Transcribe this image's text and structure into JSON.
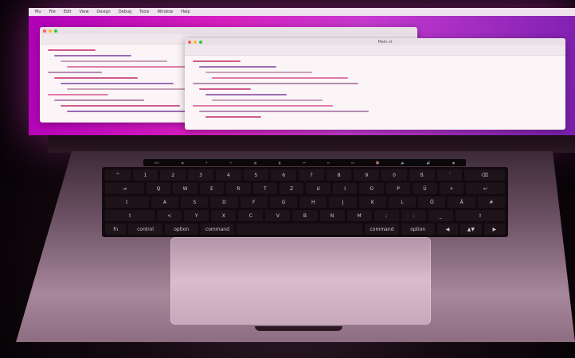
{
  "image": {
    "description_colors": {
      "screen_wallpaper": "#c81fc3",
      "body": "#7a5c70",
      "background": "#0a0508"
    }
  },
  "menubar": {
    "items": [
      "Mu",
      "File",
      "Edit",
      "View",
      "Design",
      "Debug",
      "Tools",
      "Window",
      "Help"
    ]
  },
  "window_back": {
    "title": ""
  },
  "window_front": {
    "title": "Main.st"
  },
  "touchbar": {
    "keys": [
      "esc",
      "◀",
      "☀",
      "☀",
      "▦",
      "◧",
      "⏮",
      "⏯",
      "⏭",
      "🔇",
      "🔉",
      "🔊",
      "●"
    ]
  },
  "keyboard": {
    "rows": [
      [
        "^",
        "1",
        "2",
        "3",
        "4",
        "5",
        "6",
        "7",
        "8",
        "9",
        "0",
        "ß",
        "´",
        "⌫"
      ],
      [
        "⇥",
        "Q",
        "W",
        "E",
        "R",
        "T",
        "Z",
        "U",
        "I",
        "O",
        "P",
        "Ü",
        "+",
        "↩"
      ],
      [
        "⇪",
        "A",
        "S",
        "D",
        "F",
        "G",
        "H",
        "J",
        "K",
        "L",
        "Ö",
        "Ä",
        "#"
      ],
      [
        "⇧",
        "<",
        "Y",
        "X",
        "C",
        "V",
        "B",
        "N",
        "M",
        ";",
        ":",
        "_",
        "⇧"
      ],
      [
        "fn",
        "control",
        "option",
        "command",
        "",
        "command",
        "option",
        "◀",
        "▲▼",
        "▶"
      ]
    ]
  }
}
